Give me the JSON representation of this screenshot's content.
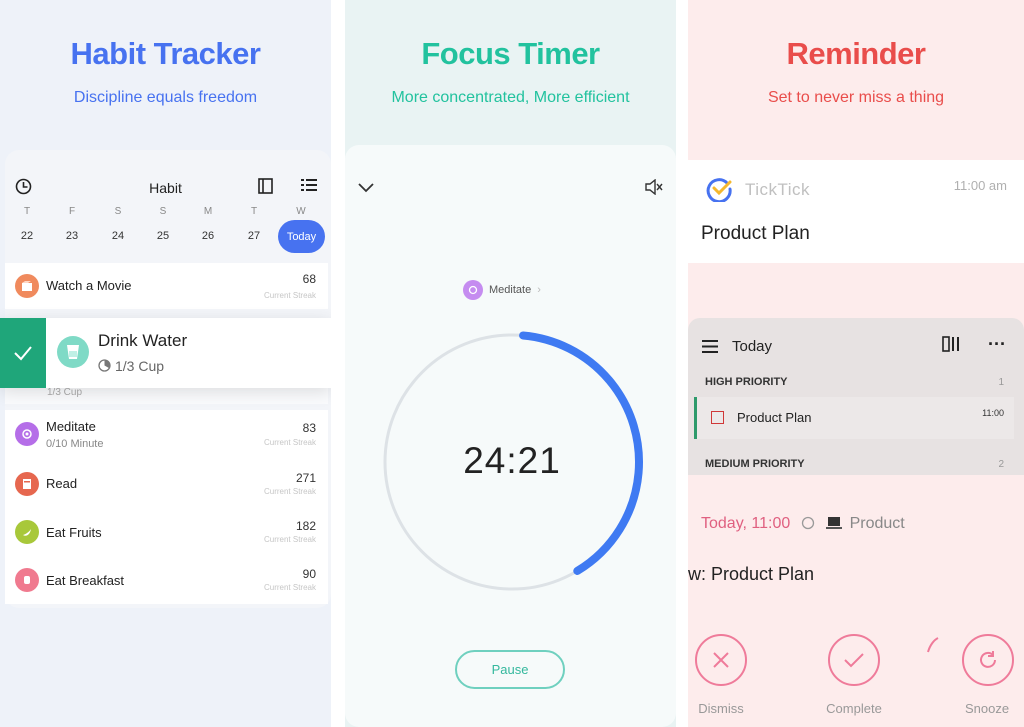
{
  "colors": {
    "habit_blue": "#4772f0",
    "focus_green": "#22c29e",
    "reminder_red": "#e94d4b",
    "pink": "#ef7b9a"
  },
  "habit": {
    "title": "Habit Tracker",
    "subtitle": "Discipline equals freedom",
    "header_title": "Habit",
    "weekdays": [
      "T",
      "F",
      "S",
      "S",
      "M",
      "T",
      "W"
    ],
    "dates": [
      "22",
      "23",
      "24",
      "25",
      "26",
      "27"
    ],
    "today_label": "Today",
    "items": [
      {
        "name": "Watch a Movie",
        "sub": "",
        "count": "68",
        "streak": "Current Streak",
        "icon": "movie-icon",
        "color": "#f08a5d"
      },
      {
        "name": "Meditate",
        "sub": "0/10 Minute",
        "count": "83",
        "streak": "Current Streak",
        "icon": "meditate-icon",
        "color": "#b56ee8"
      },
      {
        "name": "Read",
        "sub": "",
        "count": "271",
        "streak": "Current Streak",
        "icon": "book-icon",
        "color": "#e6674f"
      },
      {
        "name": "Eat Fruits",
        "sub": "",
        "count": "182",
        "streak": "Current Streak",
        "icon": "banana-icon",
        "color": "#a8c83a"
      },
      {
        "name": "Eat Breakfast",
        "sub": "",
        "count": "90",
        "streak": "Current Streak",
        "icon": "toast-icon",
        "color": "#f07a8f"
      }
    ],
    "drink": {
      "name": "Drink Water",
      "sub": "1/3 Cup",
      "hidden_sub": "1/3 Cup"
    }
  },
  "focus": {
    "title": "Focus Timer",
    "subtitle": "More concentrated, More efficient",
    "task": "Meditate",
    "time": "24:21",
    "progress": 0.4,
    "pause_label": "Pause"
  },
  "reminder": {
    "title": "Reminder",
    "subtitle": "Set to never miss a thing",
    "app_name": "TickTick",
    "notif_time": "11:00 am",
    "notif_title": "Product Plan",
    "list_title": "Today",
    "high_priority": "HIGH PRIORITY",
    "high_count": "1",
    "task_name": "Product Plan",
    "task_time": "11:00",
    "medium_priority": "MEDIUM PRIORITY",
    "medium_count": "2",
    "remind_time": "Today, 11:00",
    "remind_task": "Product",
    "big_title": "w: Product Plan",
    "actions": [
      "Dismiss",
      "Complete",
      "Snooze"
    ]
  }
}
